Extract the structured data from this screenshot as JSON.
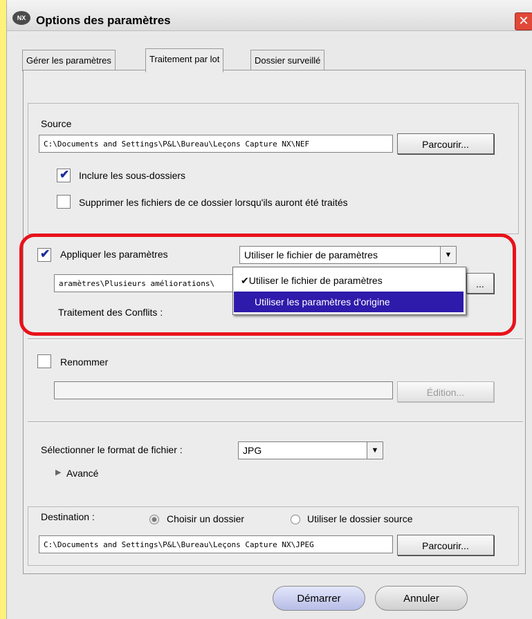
{
  "window": {
    "title": "Options des paramètres",
    "logo": "NX",
    "close_glyph": "✕"
  },
  "tabs": [
    {
      "label": "Gérer les paramètres"
    },
    {
      "label": "Traitement par lot"
    },
    {
      "label": "Dossier surveillé"
    }
  ],
  "source": {
    "label": "Source",
    "path": "C:\\Documents and Settings\\P&L\\Bureau\\Leçons Capture NX\\NEF",
    "browse_label": "Parcourir...",
    "include_subfolders": {
      "label": "Inclure les sous-dossiers",
      "checked": true
    },
    "delete_files": {
      "label": "Supprimer les fichiers de ce dossier lorsqu'ils auront été traités",
      "checked": false
    }
  },
  "apply_settings": {
    "label": "Appliquer les paramètres",
    "checked": true,
    "mode_selected": "Utiliser le fichier de paramètres",
    "file_path": "aramètres\\Plusieurs améliorations\\",
    "browse_label": "...",
    "conflicts_label": "Traitement des Conflits :",
    "dropdown_options": [
      {
        "label": "Utiliser le fichier de paramètres",
        "check": "✔"
      },
      {
        "label": "Utiliser les paramètres d'origine",
        "check": ""
      }
    ]
  },
  "rename": {
    "label": "Renommer",
    "checked": false,
    "value": "",
    "edit_label": "Édition..."
  },
  "format": {
    "label": "Sélectionner le format de fichier :",
    "value": "JPG",
    "advanced_label": "Avancé",
    "advanced_glyph": "▶"
  },
  "destination": {
    "label": "Destination :",
    "radio_choose": {
      "label": "Choisir un dossier",
      "selected": true
    },
    "radio_source": {
      "label": "Utiliser le dossier source",
      "selected": false
    },
    "path": "C:\\Documents and Settings\\P&L\\Bureau\\Leçons Capture NX\\JPEG",
    "browse_label": "Parcourir..."
  },
  "footer": {
    "start_label": "Démarrer",
    "cancel_label": "Annuler"
  },
  "icons": {
    "dropdown_arrow": "▼",
    "checkmark": "✔"
  },
  "colors": {
    "highlight_ring": "#e8121b",
    "selection": "#2e1bab",
    "check": "#1d2c9e",
    "background": "#fef27a"
  }
}
